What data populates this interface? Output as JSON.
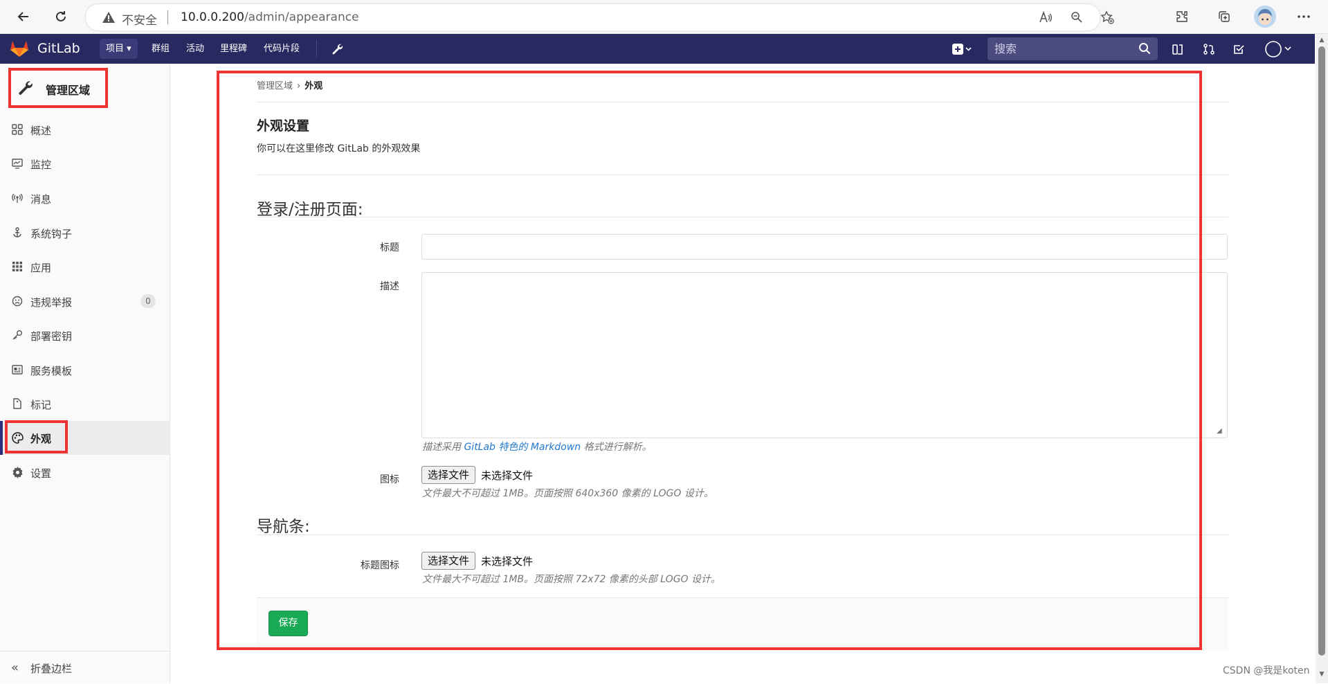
{
  "browser": {
    "insecure_label": "不安全",
    "url_host": "10.0.0.200",
    "url_path": "/admin/appearance"
  },
  "navbar": {
    "brand": "GitLab",
    "menu": [
      "项目",
      "群组",
      "活动",
      "里程碑",
      "代码片段"
    ],
    "search_placeholder": "搜索"
  },
  "sidebar": {
    "header": "管理区域",
    "items": [
      {
        "label": "概述",
        "icon": "grid-icon"
      },
      {
        "label": "监控",
        "icon": "monitor-icon"
      },
      {
        "label": "消息",
        "icon": "broadcast-icon"
      },
      {
        "label": "系统钩子",
        "icon": "hook-icon"
      },
      {
        "label": "应用",
        "icon": "apps-icon"
      },
      {
        "label": "违规举报",
        "icon": "abuse-icon",
        "badge": "0"
      },
      {
        "label": "部署密钥",
        "icon": "key-icon"
      },
      {
        "label": "服务模板",
        "icon": "template-icon"
      },
      {
        "label": "标记",
        "icon": "label-icon"
      },
      {
        "label": "外观",
        "icon": "palette-icon",
        "active": true
      },
      {
        "label": "设置",
        "icon": "gear-icon"
      }
    ],
    "collapse": "折叠边栏"
  },
  "breadcrumb": {
    "parent": "管理区域",
    "current": "外观"
  },
  "page": {
    "title": "外观设置",
    "description": "你可以在这里修改 GitLab 的外观效果"
  },
  "signin_section": {
    "title": "登录/注册页面:",
    "title_label": "标题",
    "description_label": "描述",
    "help_prefix": "描述采用 ",
    "help_link": "GitLab 特色的 Markdown",
    "help_suffix": " 格式进行解析。",
    "logo_label": "图标",
    "logo_button": "选择文件",
    "logo_none": "未选择文件",
    "logo_help": "文件最大不可超过 1MB。页面按照 640x360 像素的 LOGO 设计。"
  },
  "navbar_section": {
    "title": "导航条:",
    "header_logo_label": "标题图标",
    "header_logo_button": "选择文件",
    "header_logo_none": "未选择文件",
    "header_logo_help": "文件最大不可超过 1MB。页面按照 72x72 像素的头部 LOGO 设计。"
  },
  "save_button": "保存",
  "watermark": "CSDN @我是koten",
  "colors": {
    "navbar_bg": "#292961",
    "save_green": "#1aaa55",
    "annotation_red": "#ee3333",
    "link_blue": "#1f78d1"
  }
}
